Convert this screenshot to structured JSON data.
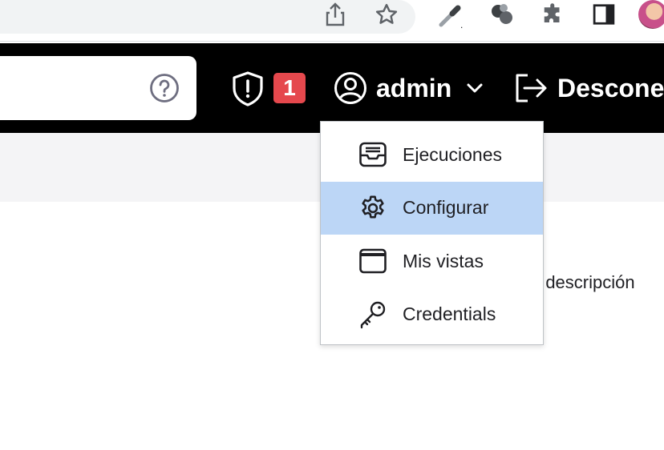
{
  "browser": {
    "icons": [
      "share-icon",
      "star-icon",
      "eyedropper-icon",
      "spheres-icon",
      "puzzle-icon",
      "sidepanel-icon"
    ],
    "profile_marker": "."
  },
  "header": {
    "notification_count": "1",
    "user_name": "admin",
    "logout_label": "Desconec"
  },
  "page": {
    "description_link": "ir descripción"
  },
  "user_menu": {
    "items": [
      {
        "label": "Ejecuciones",
        "icon": "inbox-icon"
      },
      {
        "label": "Configurar",
        "icon": "gear-icon",
        "active": true
      },
      {
        "label": "Mis vistas",
        "icon": "window-icon"
      },
      {
        "label": "Credentials",
        "icon": "key-icon"
      }
    ]
  },
  "colors": {
    "header_bg": "#000000",
    "badge": "#e5484d",
    "active_item": "#bcd6f6"
  }
}
